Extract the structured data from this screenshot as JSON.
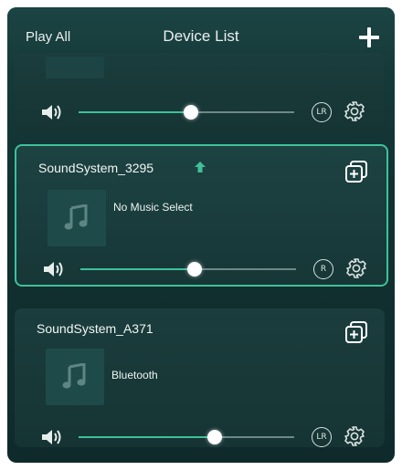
{
  "header": {
    "left_label": "Play All",
    "title": "Device List",
    "add_icon": "plus-icon"
  },
  "devices": [
    {
      "name": "",
      "now_playing": "",
      "volume": 0.52,
      "channel": "LR",
      "selected": false
    },
    {
      "name": "SoundSystem_3295",
      "master": true,
      "now_playing": "No Music Select",
      "volume": 0.53,
      "channel": "R",
      "selected": true
    },
    {
      "name": "SoundSystem_A371",
      "master": false,
      "now_playing": "Bluetooth",
      "volume": 0.63,
      "channel": "LR",
      "selected": false
    }
  ],
  "colors": {
    "accent": "#3fc09a",
    "background": "#133434",
    "card": "#1b3d3d",
    "text": "#f2f6f5"
  }
}
